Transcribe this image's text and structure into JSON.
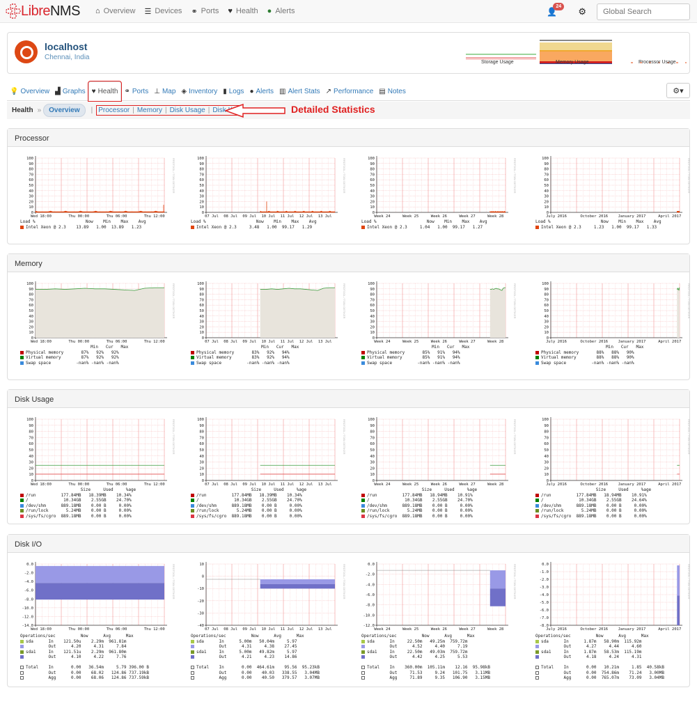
{
  "navbar": {
    "brand_libre": "Libre",
    "brand_nms": "NMS",
    "items": [
      {
        "icon": "home-icon",
        "label": "Overview"
      },
      {
        "icon": "server-icon",
        "label": "Devices"
      },
      {
        "icon": "link-icon",
        "label": "Ports"
      },
      {
        "icon": "heartbeat-icon",
        "label": "Health"
      },
      {
        "icon": "exclamation-circle-icon",
        "label": "Alerts"
      }
    ],
    "alert_count": "24",
    "search_placeholder": "Global Search"
  },
  "device": {
    "hostname": "localhost",
    "location": "Chennai, India",
    "minigraphs": [
      "Storage Usage",
      "Memory Usage",
      "Processor Usage"
    ]
  },
  "tabs": [
    {
      "icon": "lightbulb-icon",
      "label": "Overview"
    },
    {
      "icon": "area-chart-icon",
      "label": "Graphs"
    },
    {
      "icon": "heartbeat-icon",
      "label": "Health",
      "active": true
    },
    {
      "icon": "link-icon",
      "label": "Ports"
    },
    {
      "icon": "sitemap-icon",
      "label": "Map"
    },
    {
      "icon": "cube-icon",
      "label": "Inventory"
    },
    {
      "icon": "book-icon",
      "label": "Logs"
    },
    {
      "icon": "exclamation-circle-icon",
      "label": "Alerts"
    },
    {
      "icon": "bar-chart-icon",
      "label": "Alert Stats"
    },
    {
      "icon": "line-chart-icon",
      "label": "Performance"
    },
    {
      "icon": "file-icon",
      "label": "Notes"
    }
  ],
  "breadcrumb": {
    "root": "Health",
    "sep": "»",
    "current": "Overview",
    "links": [
      "Processor",
      "Memory",
      "Disk Usage",
      "Disk I/O"
    ]
  },
  "annotation": "Detailed Statistics",
  "watermark": "RRDTOOL / TOBI OETIKER",
  "periods": [
    {
      "xticks": [
        "Wed 18:00",
        "Thu 00:00",
        "Thu 06:00",
        "Thu 12:00"
      ]
    },
    {
      "xticks": [
        "07 Jul",
        "08 Jul",
        "09 Jul",
        "10 Jul",
        "11 Jul",
        "12 Jul",
        "13 Jul"
      ]
    },
    {
      "xticks": [
        "Week 24",
        "Week 25",
        "Week 26",
        "Week 27",
        "Week 28"
      ]
    },
    {
      "xticks": [
        "July 2016",
        "October 2016",
        "January 2017",
        "April 2017"
      ]
    }
  ],
  "sections": {
    "processor": {
      "title": "Processor",
      "yticks": [
        "100",
        "90",
        "80",
        "70",
        "60",
        "50",
        "40",
        "30",
        "20",
        "10",
        "0"
      ],
      "legend_header": {
        "label": "Load %",
        "cols": [
          "Now",
          "Min",
          "Max",
          "Avg"
        ]
      },
      "graphs": [
        {
          "rows": [
            {
              "name": "Intel Xeon @ 2.3",
              "color": "#e0440e",
              "values": [
                "13.89",
                "1.00",
                "13.89",
                "1.23"
              ]
            }
          ]
        },
        {
          "rows": [
            {
              "name": "Intel Xeon @ 2.3",
              "color": "#e0440e",
              "values": [
                "3.48",
                "1.00",
                "99.17",
                "1.29"
              ]
            }
          ]
        },
        {
          "rows": [
            {
              "name": "Intel Xeon @ 2.3",
              "color": "#e0440e",
              "values": [
                "1.04",
                "1.00",
                "99.17",
                "1.27"
              ]
            }
          ]
        },
        {
          "rows": [
            {
              "name": "Intel Xeon @ 2.3",
              "color": "#e0440e",
              "values": [
                "1.23",
                "1.00",
                "99.17",
                "1.33"
              ]
            }
          ]
        }
      ]
    },
    "memory": {
      "title": "Memory",
      "yticks": [
        "100",
        "90",
        "80",
        "70",
        "60",
        "50",
        "40",
        "30",
        "20",
        "10",
        "0"
      ],
      "legend_header": {
        "label": "",
        "cols": [
          "Min",
          "Cur",
          "Max"
        ]
      },
      "graphs": [
        {
          "rows": [
            {
              "name": "Physical memory",
              "color": "#c00000",
              "values": [
                "87%",
                "92%",
                "92%"
              ]
            },
            {
              "name": "Virtual memory",
              "color": "#008000",
              "values": [
                "87%",
                "92%",
                "92%"
              ]
            },
            {
              "name": "Swap space",
              "color": "#3a8bdc",
              "values": [
                "-nan%",
                "-nan%",
                "-nan%"
              ]
            }
          ]
        },
        {
          "rows": [
            {
              "name": "Physical memory",
              "color": "#c00000",
              "values": [
                "83%",
                "92%",
                "94%"
              ]
            },
            {
              "name": "Virtual memory",
              "color": "#008000",
              "values": [
                "83%",
                "92%",
                "94%"
              ]
            },
            {
              "name": "Swap space",
              "color": "#3a8bdc",
              "values": [
                "-nan%",
                "-nan%",
                "-nan%"
              ]
            }
          ]
        },
        {
          "rows": [
            {
              "name": "Physical memory",
              "color": "#c00000",
              "values": [
                "85%",
                "91%",
                "94%"
              ]
            },
            {
              "name": "Virtual memory",
              "color": "#008000",
              "values": [
                "85%",
                "91%",
                "94%"
              ]
            },
            {
              "name": "Swap space",
              "color": "#3a8bdc",
              "values": [
                "-nan%",
                "-nan%",
                "-nan%"
              ]
            }
          ]
        },
        {
          "rows": [
            {
              "name": "Physical memory",
              "color": "#c00000",
              "values": [
                "88%",
                "88%",
                "90%"
              ]
            },
            {
              "name": "Virtual memory",
              "color": "#008000",
              "values": [
                "88%",
                "88%",
                "90%"
              ]
            },
            {
              "name": "Swap space",
              "color": "#3a8bdc",
              "values": [
                "-nan%",
                "-nan%",
                "-nan%"
              ]
            }
          ]
        }
      ]
    },
    "disk_usage": {
      "title": "Disk Usage",
      "yticks": [
        "100",
        "90",
        "80",
        "70",
        "60",
        "50",
        "40",
        "30",
        "20",
        "10",
        "0"
      ],
      "legend_header": {
        "label": "",
        "cols": [
          "Size",
          "Used",
          "%age"
        ]
      },
      "graphs": [
        {
          "rows": [
            {
              "name": "/run",
              "color": "#c00000",
              "values": [
                "177.84MB",
                "18.39MB",
                "10.34%"
              ]
            },
            {
              "name": "/",
              "color": "#008000",
              "values": [
                "10.34GB",
                "2.55GB",
                "24.70%"
              ]
            },
            {
              "name": "/dev/shm",
              "color": "#3a8bdc",
              "values": [
                "889.18MB",
                "0.00 B",
                "0.00%"
              ]
            },
            {
              "name": "/run/lock",
              "color": "#6b8e23",
              "values": [
                "5.24MB",
                "0.00 B",
                "0.00%"
              ]
            },
            {
              "name": "/sys/fs/cgro",
              "color": "#dc3545",
              "values": [
                "889.18MB",
                "0.00 B",
                "0.00%"
              ]
            }
          ]
        },
        {
          "rows": [
            {
              "name": "/run",
              "color": "#c00000",
              "values": [
                "177.84MB",
                "18.39MB",
                "10.34%"
              ]
            },
            {
              "name": "/",
              "color": "#008000",
              "values": [
                "10.34GB",
                "2.55GB",
                "24.70%"
              ]
            },
            {
              "name": "/dev/shm",
              "color": "#3a8bdc",
              "values": [
                "889.18MB",
                "0.00 B",
                "0.00%"
              ]
            },
            {
              "name": "/run/lock",
              "color": "#6b8e23",
              "values": [
                "5.24MB",
                "0.00 B",
                "0.00%"
              ]
            },
            {
              "name": "/sys/fs/cgro",
              "color": "#dc3545",
              "values": [
                "889.18MB",
                "0.00 B",
                "0.00%"
              ]
            }
          ]
        },
        {
          "rows": [
            {
              "name": "/run",
              "color": "#c00000",
              "values": [
                "177.84MB",
                "18.94MB",
                "10.91%"
              ]
            },
            {
              "name": "/",
              "color": "#008000",
              "values": [
                "10.34GB",
                "2.55GB",
                "24.70%"
              ]
            },
            {
              "name": "/dev/shm",
              "color": "#3a8bdc",
              "values": [
                "889.18MB",
                "0.00 B",
                "0.00%"
              ]
            },
            {
              "name": "/run/lock",
              "color": "#6b8e23",
              "values": [
                "5.24MB",
                "0.00 B",
                "0.00%"
              ]
            },
            {
              "name": "/sys/fs/cgro",
              "color": "#dc3545",
              "values": [
                "889.18MB",
                "0.00 B",
                "0.00%"
              ]
            }
          ]
        },
        {
          "rows": [
            {
              "name": "/run",
              "color": "#c00000",
              "values": [
                "177.84MB",
                "18.94MB",
                "10.91%"
              ]
            },
            {
              "name": "/",
              "color": "#008000",
              "values": [
                "10.34GB",
                "2.55GB",
                "24.64%"
              ]
            },
            {
              "name": "/dev/shm",
              "color": "#3a8bdc",
              "values": [
                "889.18MB",
                "0.00 B",
                "0.00%"
              ]
            },
            {
              "name": "/run/lock",
              "color": "#6b8e23",
              "values": [
                "5.24MB",
                "0.00 B",
                "0.00%"
              ]
            },
            {
              "name": "/sys/fs/cgro",
              "color": "#dc3545",
              "values": [
                "889.18MB",
                "0.00 B",
                "0.00%"
              ]
            }
          ]
        }
      ]
    },
    "disk_io": {
      "title": "Disk I/O",
      "legend_header": {
        "label": "Operations/sec",
        "cols": [
          "Now",
          "Avg",
          "Max"
        ]
      },
      "graphs": [
        {
          "yticks": [
            "0.0",
            "-2.0",
            "-4.0",
            "-6.0",
            "-8.0",
            "-10.0",
            "-12.0",
            "-14.0"
          ],
          "rows": [
            [
              "sda",
              "In",
              "121.50u",
              "2.29m",
              "961.81m"
            ],
            [
              "",
              "Out",
              "4.20",
              "4.31",
              "7.84"
            ],
            [
              "sda1",
              "In",
              "121.51u",
              "2.29m",
              "961.80m"
            ],
            [
              "",
              "Out",
              "4.10",
              "4.22",
              "7.76"
            ]
          ],
          "totals": [
            [
              "Total",
              "In",
              "0.00",
              "36.54m",
              "5.79",
              "396.00 B"
            ],
            [
              "",
              "Out",
              "0.00",
              "68.02",
              "124.86",
              "737.19kB"
            ],
            [
              "",
              "Agg",
              "0.00",
              "68.06",
              "124.86",
              "737.59kB"
            ]
          ]
        },
        {
          "yticks": [
            "10",
            "0",
            "-10",
            "-20",
            "-30",
            "-40"
          ],
          "rows": [
            [
              "sda",
              "In",
              "5.00m",
              "50.04m",
              "5.97"
            ],
            [
              "",
              "Out",
              "4.31",
              "4.38",
              "27.45"
            ],
            [
              "sda1",
              "In",
              "5.00m",
              "49.82m",
              "5.97"
            ],
            [
              "",
              "Out",
              "4.21",
              "4.23",
              "14.86"
            ]
          ],
          "totals": [
            [
              "Total",
              "In",
              "0.00",
              "464.61m",
              "95.56",
              "95.23kB"
            ],
            [
              "",
              "Out",
              "0.00",
              "40.03",
              "338.55",
              "3.04MB"
            ],
            [
              "",
              "Agg",
              "0.00",
              "40.50",
              "379.57",
              "3.07MB"
            ]
          ]
        },
        {
          "yticks": [
            "0.0",
            "-2.0",
            "-4.0",
            "-6.0",
            "-8.0",
            "-10.0",
            "-12.0"
          ],
          "rows": [
            [
              "sda",
              "In",
              "22.50m",
              "49.25m",
              "759.72m"
            ],
            [
              "",
              "Out",
              "4.52",
              "4.40",
              "7.19"
            ],
            [
              "sda1",
              "In",
              "22.50m",
              "49.03m",
              "759.72m"
            ],
            [
              "",
              "Out",
              "4.42",
              "4.25",
              "5.53"
            ]
          ],
          "totals": [
            [
              "Total",
              "In",
              "360.00m",
              "105.11m",
              "12.16",
              "95.98kB"
            ],
            [
              "",
              "Out",
              "71.53",
              "9.24",
              "101.75",
              "3.11MB"
            ],
            [
              "",
              "Agg",
              "71.89",
              "9.35",
              "106.90",
              "3.15MB"
            ]
          ]
        },
        {
          "yticks": [
            "0.0",
            "-1.0",
            "-2.0",
            "-3.0",
            "-4.0",
            "-5.0",
            "-6.0",
            "-7.0",
            "-8.0"
          ],
          "rows": [
            [
              "sda",
              "In",
              "1.87m",
              "58.90m",
              "115.92m"
            ],
            [
              "",
              "Out",
              "4.27",
              "4.44",
              "4.60"
            ],
            [
              "sda1",
              "In",
              "1.87m",
              "58.53m",
              "115.19m"
            ],
            [
              "",
              "Out",
              "4.18",
              "4.24",
              "4.31"
            ]
          ],
          "totals": [
            [
              "Total",
              "In",
              "0.00",
              "10.21m",
              "1.85",
              "40.58kB"
            ],
            [
              "",
              "Out",
              "0.00",
              "754.86m",
              "71.24",
              "3.00MB"
            ],
            [
              "",
              "Agg",
              "0.00",
              "765.07m",
              "73.09",
              "3.04MB"
            ]
          ]
        }
      ]
    }
  },
  "io_colors": [
    "#a8c84a",
    "#9999e6",
    "#7a9a2a",
    "#7070c8"
  ]
}
